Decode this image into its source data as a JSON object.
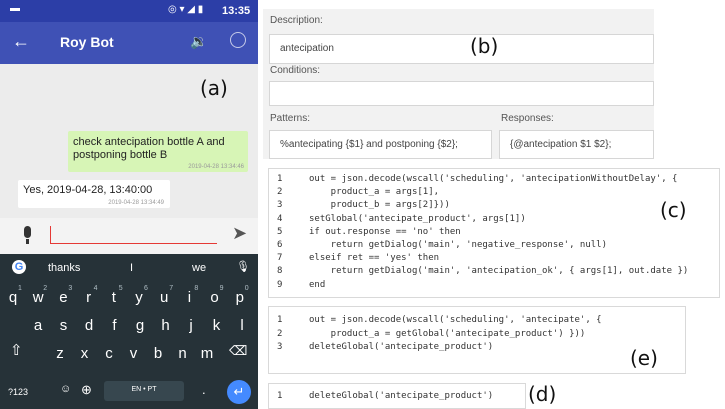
{
  "phone": {
    "status_time": "13:35",
    "app_title": "Roy Bot",
    "label": "(a)",
    "msg_out": "check antecipation bottle A and postponing bottle B",
    "msg_out_time": "2019-04-28 13:34:46",
    "msg_in": "Yes, 2019-04-28, 13:40:00",
    "msg_in_time": "2019-04-28 13:34:49",
    "suggestions": [
      "thanks",
      "I",
      "we"
    ],
    "row1": [
      "q",
      "w",
      "e",
      "r",
      "t",
      "y",
      "u",
      "i",
      "o",
      "p"
    ],
    "row1_sup": [
      "1",
      "2",
      "3",
      "4",
      "5",
      "6",
      "7",
      "8",
      "9",
      "0"
    ],
    "row2": [
      "a",
      "s",
      "d",
      "f",
      "g",
      "h",
      "j",
      "k",
      "l"
    ],
    "row3": [
      "z",
      "x",
      "c",
      "v",
      "b",
      "n",
      "m"
    ],
    "sym_key": "?123",
    "lang_key": "EN • PT",
    "dot_key": "."
  },
  "form": {
    "description_label": "Description:",
    "description_value": "antecipation",
    "label_b": "(b)",
    "conditions_label": "Conditions:",
    "patterns_label": "Patterns:",
    "responses_label": "Responses:",
    "pattern_value": "%antecipating {$1} and postponing {$2};",
    "response_value": "{@antecipation $1 $2};"
  },
  "code_c": {
    "label": "(c)",
    "lines": [
      "out = json.decode(wscall('scheduling', 'antecipationWithoutDelay', {",
      "    product_a = args[1],",
      "    product_b = args[2]}))",
      "setGlobal('antecipate_product', args[1])",
      "if out.response == 'no' then",
      "    return getDialog('main', 'negative_response', null)",
      "elseif ret == 'yes' then",
      "    return getDialog('main', 'antecipation_ok', { args[1], out.date })",
      "end"
    ]
  },
  "code_e": {
    "label": "(e)",
    "lines": [
      "out = json.decode(wscall('scheduling', 'antecipate', {",
      "    product_a = getGlobal('antecipate_product') }))",
      "deleteGlobal('antecipate_product')"
    ]
  },
  "code_d": {
    "label": "(d)",
    "lines": [
      "deleteGlobal('antecipate_product')"
    ]
  },
  "colors": {
    "appbar": "#3f51b5",
    "status": "#2c3ea7",
    "bubble_out": "#d7f5b6",
    "keyboard": "#263238",
    "accent_red": "#e53935",
    "enter": "#448aff"
  }
}
